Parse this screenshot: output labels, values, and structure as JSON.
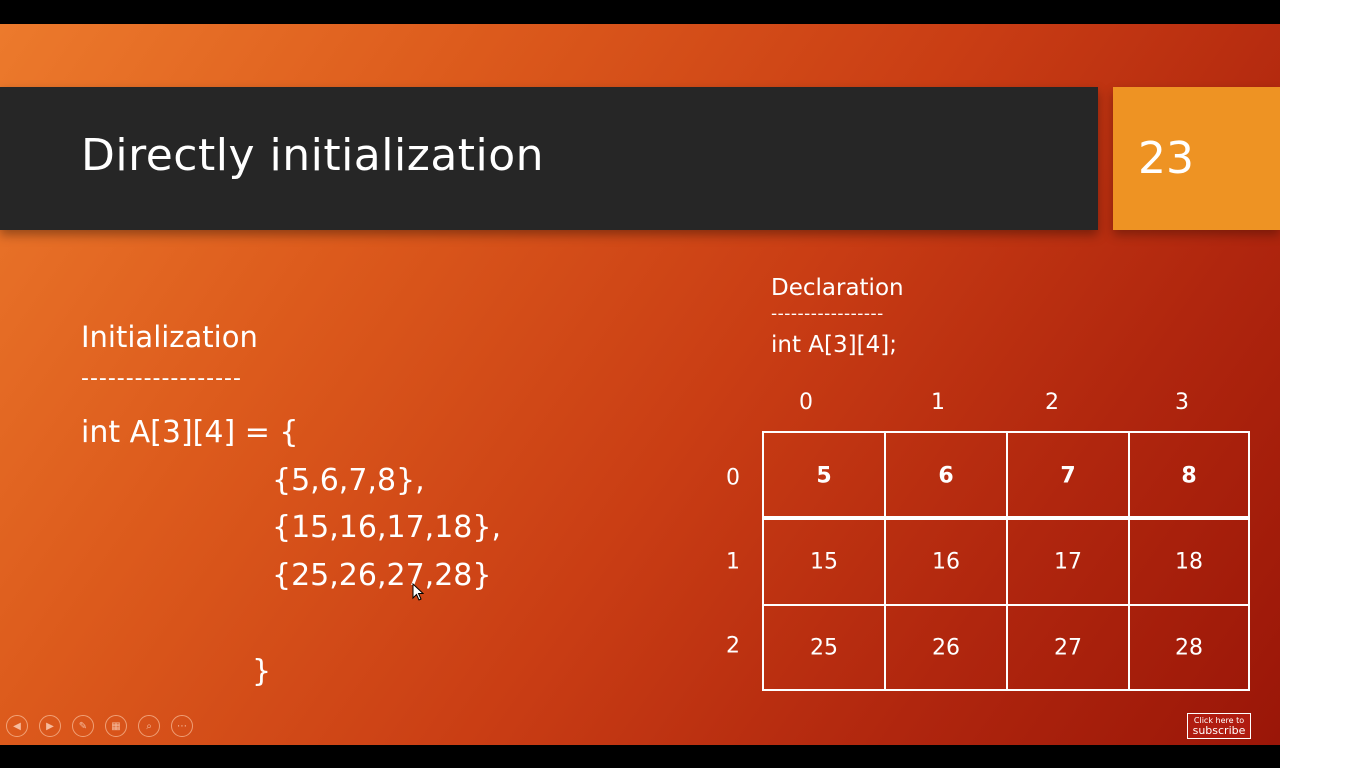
{
  "slide": {
    "title": "Directly initialization",
    "number": "23",
    "initialization": {
      "label": "Initialization",
      "dashes": "------------------",
      "lines": [
        "int A[3][4] = {",
        "{5,6,7,8},",
        "{15,16,17,18},",
        "{25,26,27,28}",
        "}"
      ]
    },
    "declaration": {
      "label": "Declaration",
      "dashes": "-----------------",
      "code": "int A[3][4];"
    },
    "table": {
      "col_headers": [
        "0",
        "1",
        "2",
        "3"
      ],
      "row_headers": [
        "0",
        "1",
        "2"
      ],
      "rows": [
        [
          "5",
          "6",
          "7",
          "8"
        ],
        [
          "15",
          "16",
          "17",
          "18"
        ],
        [
          "25",
          "26",
          "27",
          "28"
        ]
      ]
    }
  },
  "controls": {
    "icons": [
      "previous-icon",
      "next-icon",
      "pen-icon",
      "slides-icon",
      "zoom-icon",
      "more-icon"
    ],
    "subscribe": {
      "line1": "Click here to",
      "line2": "subscribe"
    }
  }
}
